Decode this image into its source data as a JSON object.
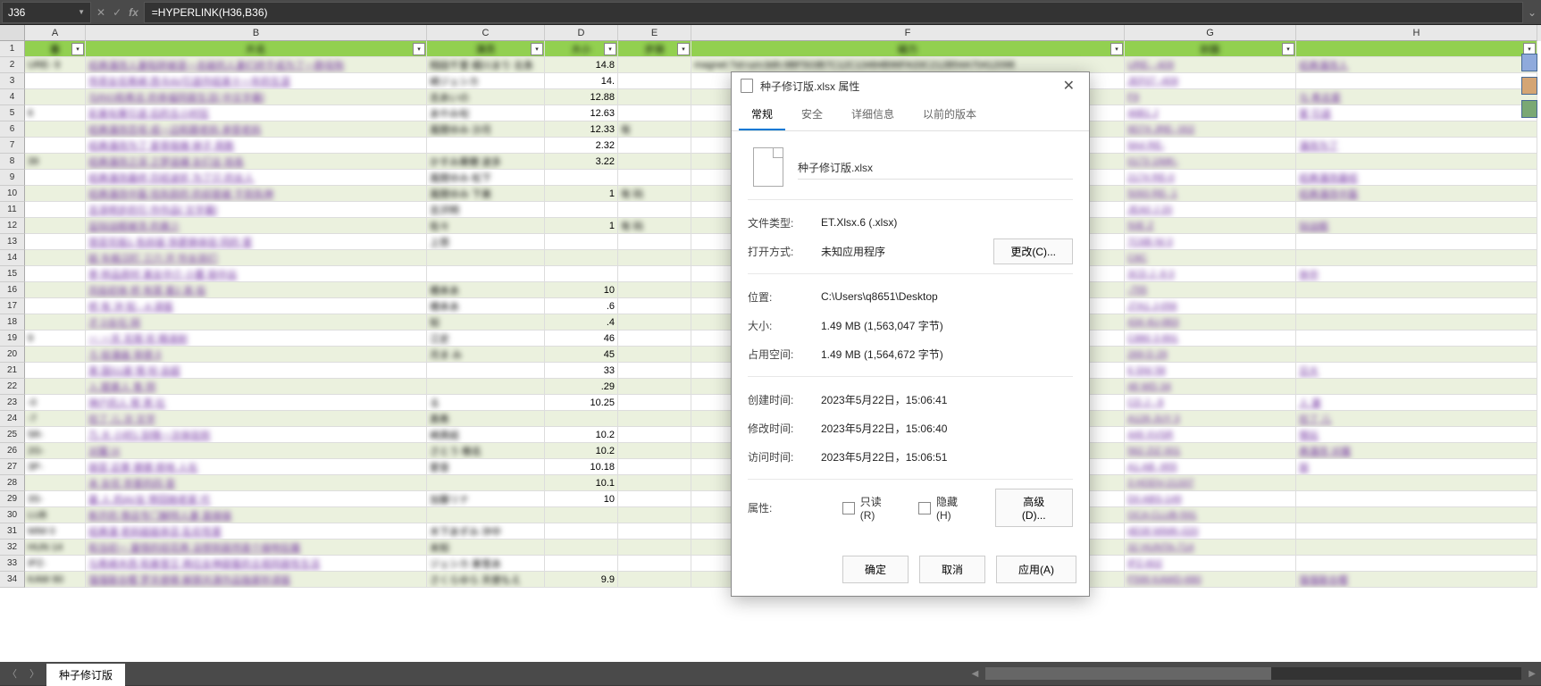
{
  "formulaBar": {
    "nameBox": "J36",
    "formula": "=HYPERLINK(H36,B36)"
  },
  "columns": [
    "A",
    "B",
    "C",
    "D",
    "E",
    "F",
    "G",
    "H"
  ],
  "headers": {
    "A": "番",
    "B": "片名",
    "C": "演员",
    "D": "大小",
    "E": "步骑",
    "F": "磁力",
    "G": "封面",
    "H": ""
  },
  "rows": [
    {
      "n": 2,
      "A": "URE-  9",
      "B": "经典漫改人妻陷阱被逐一击破的人妻们终于成为了一群母狗",
      "C": "翔田千里 细川まり 北条",
      "D": "14.8",
      "E": "",
      "F": "magnet:?xt=urn:btih:9BF503B7C12C13484B96FA33C212B54A70412098",
      "G": "URE-  -409",
      "H": "经典漫改人"
    },
    {
      "n": 3,
      "A": "",
      "B": "传奇女优希崎   西卡AV引退作结束十一年的生涯",
      "C": "崎ジェシカ",
      "D": "14.",
      "E": "",
      "F": "",
      "G": "JEF07  -409",
      "H": ""
    },
    {
      "n": 4,
      "A": "",
      "B": "与RIO和希志  的幸福同居生活[   中文字幕]",
      "C": "志あいの",
      "D": "12.88",
      "E": "",
      "F": "",
      "G": "F9",
      "H": "与   希志爱"
    },
    {
      "n": 5,
      "A": "  6",
      "B": "彩美旬果引退   后的五小时狂",
      "C": "あやみ旬",
      "D": "12.63",
      "E": "",
      "F": "",
      "G": "46B1   J",
      "H": "爱   引退"
    },
    {
      "n": 6,
      "A": "",
      "B": "经典漫改恋母   成一边和跟老妈        承受老妈",
      "C": "風間ゆみ 沙月",
      "D": "12.33",
      "E": "有",
      "F": "",
      "G": "9D74   JRE- 002",
      "H": ""
    },
    {
      "n": 7,
      "A": "",
      "B": "经典漫改为了   夏哥我赌       婞子    周数",
      "C": "",
      "D": "2.32",
      "E": "",
      "F": "",
      "G": "9A4    RE-",
      "H": "漫改为了"
    },
    {
      "n": 8,
      "A": "  39",
      "B": "经典漫改之深   之梦追捕       女们全       拾各",
      "C": "かすみ果穂 波多",
      "D": "3.22",
      "E": "",
      "F": "",
      "G": "0173   1IMK-",
      "H": ""
    },
    {
      "n": 9,
      "A": "",
      "B": "经典漫改最终   历经波折      为了只      的女人",
      "C": "風間ゆみ        松下",
      "D": "",
      "E": "",
      "F": "",
      "G": "2174   RE-0",
      "H": "经典漫改最经"
    },
    {
      "n": 10,
      "A": "",
      "B": "经典漫改中篇   找失踪的   的却是被       干到失神",
      "C": "風間ゆみ   下美",
      "D": "1",
      "E": "有 码",
      "F": "",
      "G": "5093   RE-  1",
      "H": "经典漫改中篇"
    },
    {
      "n": 11,
      "A": "",
      "B": "吉泽明步的引   作作品[    文字幕]",
      "C": "吉沢明",
      "D": "",
      "E": "",
      "F": "",
      "G": "JEA0   J 20",
      "H": ""
    },
    {
      "n": 12,
      "A": "",
      "B": "监狱战舰被洗   的美少",
      "C": "        佐々",
      "D": "1",
      "E": "有 码",
      "F": "",
      "G": "50E    Z",
      "H": "狱战舰 "
    },
    {
      "n": 13,
      "A": "",
      "B": "  悠亚究极1   色扮装  饰更换体验  同的  爱",
      "C": "  上悠",
      "D": "",
      "E": "",
      "F": "",
      "G": "7C6B   NI  0",
      "H": ""
    },
    {
      "n": 14,
      "A": "",
      "B": "殴  车痴汉盯  三穴  开    怜女孩们",
      "C": "",
      "D": "",
      "E": "",
      "F": "",
      "G": "C6C    ",
      "H": ""
    },
    {
      "n": 15,
      "A": "",
      "B": "参  样品房时   美女中介   小蕾             丽中出",
      "C": "",
      "D": "",
      "E": "",
      "F": "",
      "G": "3CD    J -9 0",
      "H": "   休中"
    },
    {
      "n": 16,
      "A": "",
      "B": "风俗初体   桥  有菜     套2  高     俗",
      "C": "橋本あ",
      "D": "10",
      "E": "",
      "F": "",
      "G": "       -755",
      "H": ""
    },
    {
      "n": 17,
      "A": "",
      "B": "   桥  有    沖    知    -  A    译版",
      "C": "橋本あ",
      "D": ".6",
      "E": "",
      "F": "",
      "G": "J7A1   J-056",
      "H": ""
    },
    {
      "n": 18,
      "A": "",
      "B": "     才    D女社     网",
      "C": "知",
      "D": ".4",
      "E": "",
      "F": "",
      "G": "434    4U-883",
      "H": "    "
    },
    {
      "n": 19,
      "A": "  9",
      "B": "  一  一天   无限           欢   精液射",
      "C": "江史",
      "D": "46",
      "E": "",
      "F": "",
      "G": "C880   3  891",
      "H": ""
    },
    {
      "n": 20,
      "A": "",
      "B": "   ろ    绘漫画     背德                δ",
      "C": "  月ま       み",
      "D": "45",
      "E": "",
      "F": "",
      "G": "269    D   29",
      "H": ""
    },
    {
      "n": 21,
      "A": "",
      "B": "  黑  国S1豪    情     吩    会超  ",
      "C": "",
      "D": "33",
      "E": "",
      "F": "",
      "G": "6      SNI  58",
      "H": "日大"
    },
    {
      "n": 22,
      "A": "",
      "B": "  入 醛素人 售           阴    ",
      "C": "",
      "D": ".29",
      "E": "",
      "F": "",
      "G": "48     WD  34",
      "H": ""
    },
    {
      "n": 23,
      "A": "-0 ",
      "B": "    神户的人          帮  男        社",
      "C": "    る",
      "D": "10.25",
      "E": "",
      "F": "",
      "G": "CD     J -   8",
      "H": " 人 妻"
    },
    {
      "n": 24,
      "A": "-7   ",
      "B": "     捡了  儿     次      文字",
      "C": "     真希",
      "D": "",
      "E": "",
      "F": "",
      "G": "A126   JUY  3",
      "H": "    捡了     儿"
    },
    {
      "n": 25,
      "A": "5R-",
      "B": "        乃     大      小时1   刮情一次体验到",
      "C": "   崎真結",
      "D": "10.2",
      "E": "",
      "F": "",
      "G": "449    XVSR",
      "H": "情玩 "
    },
    {
      "n": 26,
      "A": "2G-",
      "B": "          对魔  IX",
      "C": "さとう      椎名",
      "D": "10.2",
      "E": "",
      "F": "",
      "G": "562    ZIZ  001",
      "H": "  典漫改 对魔"
    },
    {
      "n": 27,
      "A": "3P-",
      "B": "     丽亚    近景   猥猥   捺地   人化",
      "C": "愛音         ",
      "D": "10.18",
      "E": "",
      "F": "",
      "G": "A1     AB  -955",
      "H": "    丽"
    },
    {
      "n": 28,
      "A": "",
      "B": "         未   女优    奈爱的四      音",
      "C": "",
      "D": "10.1",
      "E": "",
      "F": "",
      "G": "3      HODV-21337",
      "H": ""
    },
    {
      "n": 29,
      "A": "3S-",
      "B": "最 人        的AV女                带回她老家         代",
      "C": "加藤リナ",
      "D": "10",
      "E": "",
      "F": "",
      "G": "D0     ABS-149",
      "H": ""
    },
    {
      "n": 30,
      "A": "LUB",
      "B": "新开的   尊店专门解特人妻           直接操",
      "C": "",
      "D": "",
      "E": "",
      "F": "",
      "G": "OCA    CLUB-591",
      "H": ""
    },
    {
      "n": 31,
      "A": "MIM    0",
      "B": "经典漫    老妈姐姐亲忌    乱伦性爱",
      "C": "木下あずみ 沖中",
      "D": "",
      "E": "",
      "F": "",
      "G": "4E08   MIMK-020",
      "H": ""
    },
    {
      "n": 32,
      "A": "HUN   14",
      "B": "和当初一  童憶的班花再    没想到居然是个接吻狂魔",
      "C": "未知",
      "D": "",
      "E": "",
      "F": "",
      "G": "32     HUNTA-714",
      "H": ""
    },
    {
      "n": 33,
      "A": "IPZ-",
      "B": "与希崎木西    和美雪艾         两位女神甜蜜的主观同居性生活",
      "C": "  ジェシカ 美雪あ",
      "D": "",
      "E": "",
      "F": "",
      "G": "       IPZ-602",
      "H": ""
    },
    {
      "n": 34,
      "A": "KAW    80",
      "B": "强强联合樱    罗天使萌   解禁共演作品独家听译版",
      "C": "さくらゆら 天使もえ",
      "D": "9.9",
      "E": "",
      "F": "",
      "G": "F599   KAWD-680",
      "H": "强强联合樱 "
    }
  ],
  "dialog": {
    "title": "种子修订版.xlsx 属性",
    "tabs": {
      "general": "常规",
      "security": "安全",
      "details": "详细信息",
      "previous": "以前的版本"
    },
    "filename": "种子修订版.xlsx",
    "fields": {
      "fileTypeLabel": "文件类型:",
      "fileType": "ET.Xlsx.6 (.xlsx)",
      "openWithLabel": "打开方式:",
      "openWith": "未知应用程序",
      "changeBtn": "更改(C)...",
      "locationLabel": "位置:",
      "location": "C:\\Users\\q8651\\Desktop",
      "sizeLabel": "大小:",
      "size": "1.49 MB (1,563,047 字节)",
      "diskLabel": "占用空间:",
      "disk": "1.49 MB (1,564,672 字节)",
      "createdLabel": "创建时间:",
      "created": "2023年5月22日，15:06:41",
      "modifiedLabel": "修改时间:",
      "modified": "2023年5月22日，15:06:40",
      "accessedLabel": "访问时间:",
      "accessed": "2023年5月22日，15:06:51",
      "attrLabel": "属性:",
      "readonly": "只读(R)",
      "hidden": "隐藏(H)",
      "advanced": "高级(D)..."
    },
    "buttons": {
      "ok": "确定",
      "cancel": "取消",
      "apply": "应用(A)"
    }
  },
  "tabBar": {
    "sheetName": "种子修订版"
  }
}
